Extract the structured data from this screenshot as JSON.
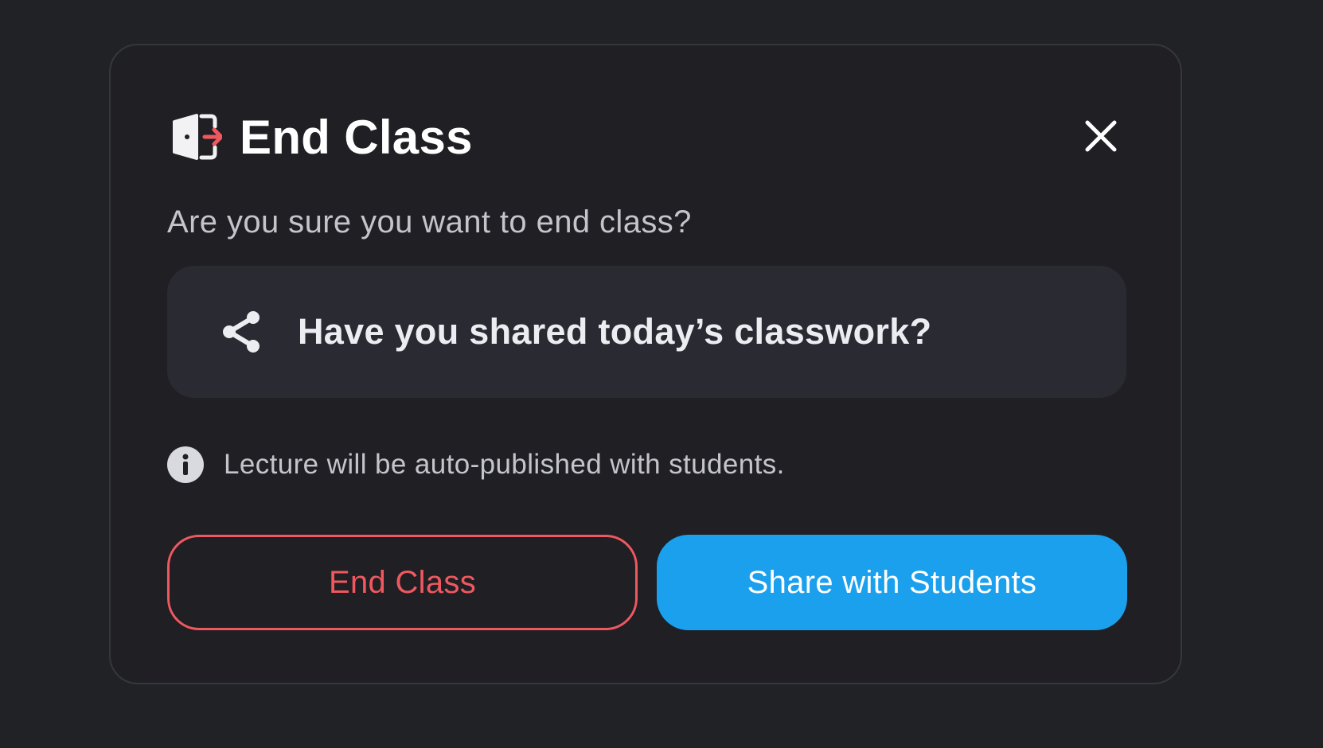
{
  "dialog": {
    "title": "End Class",
    "close_icon": "close-icon",
    "title_icon": "door-exit-icon",
    "subtitle": "Are you sure you want to end class?",
    "share_prompt": {
      "icon": "share-icon",
      "text": "Have you shared today’s classwork?"
    },
    "info": {
      "icon": "info-icon",
      "text": "Lecture will be auto-published with students."
    },
    "buttons": {
      "end_label": "End Class",
      "share_label": "Share with Students"
    }
  },
  "colors": {
    "background": "#202226",
    "modal": "#1f1f24",
    "card": "#2a2a33",
    "danger": "#f0585f",
    "primary": "#1ba0ee"
  }
}
